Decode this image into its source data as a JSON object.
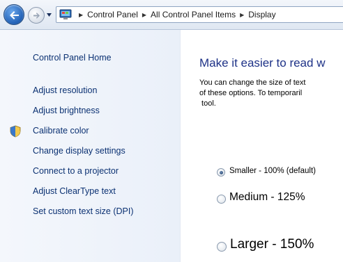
{
  "addressbar": {
    "crumbs": [
      "Control Panel",
      "All Control Panel Items",
      "Display"
    ],
    "icons": {
      "back": "back-arrow-icon",
      "forward": "forward-arrow-icon",
      "recent": "dropdown-icon",
      "location": "control-panel-icon"
    }
  },
  "sidebar": {
    "home": "Control Panel Home",
    "tasks": [
      {
        "label": "Adjust resolution",
        "icon": null
      },
      {
        "label": "Adjust brightness",
        "icon": null
      },
      {
        "label": "Calibrate color",
        "icon": "shield-icon"
      },
      {
        "label": "Change display settings",
        "icon": null
      },
      {
        "label": "Connect to a projector",
        "icon": null
      },
      {
        "label": "Adjust ClearType text",
        "icon": null
      },
      {
        "label": "Set custom text size (DPI)",
        "icon": null
      }
    ]
  },
  "main": {
    "title": "Make it easier to read w",
    "description_lines": [
      "You can change the size of text",
      "of these options. To temporaril",
      " tool."
    ],
    "options": [
      {
        "label": "Smaller - 100% (default)",
        "selected": true
      },
      {
        "label": "Medium - 125%",
        "selected": false
      },
      {
        "label": "Larger - 150%",
        "selected": false
      }
    ]
  },
  "colors": {
    "link": "#0b3172",
    "title": "#1e3287",
    "sidebar_bg": "#eaf0f9"
  }
}
